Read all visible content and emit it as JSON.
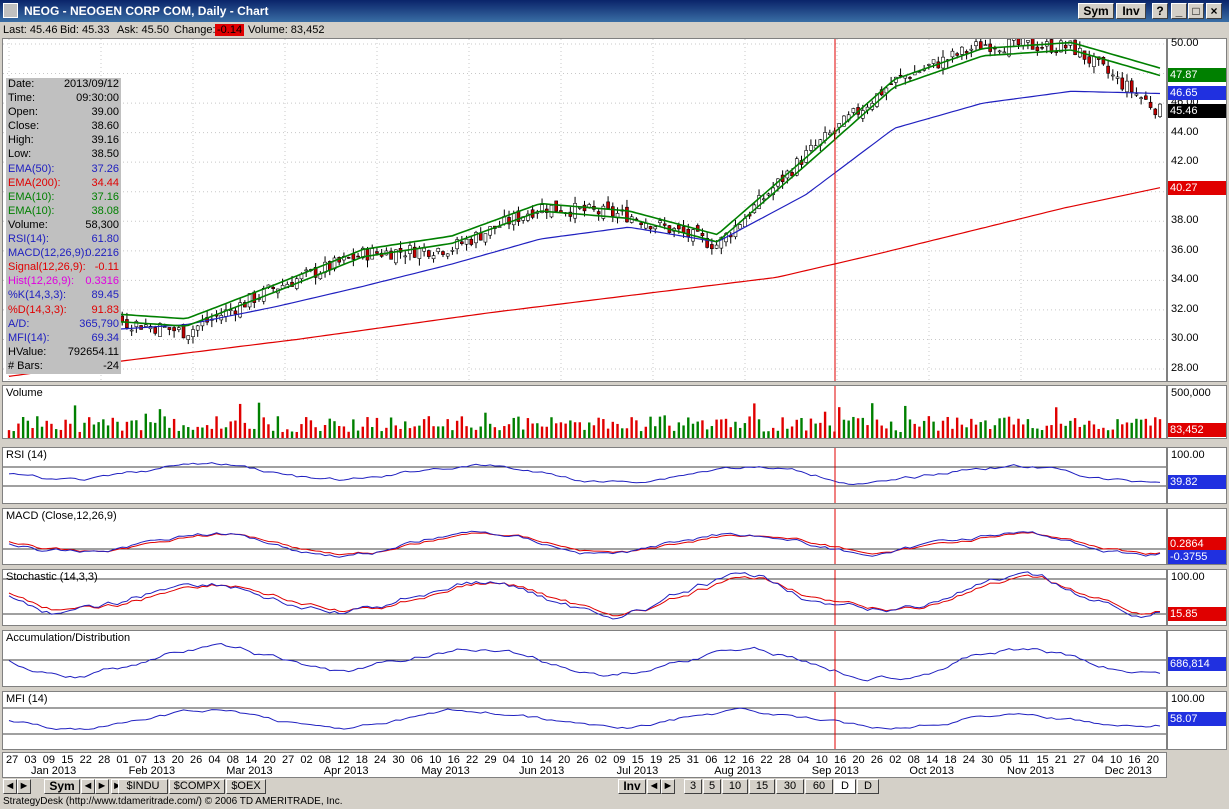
{
  "window": {
    "title": "NEOG - NEOGEN CORP COM, Daily - Chart",
    "sym_btn": "Sym",
    "inv_btn": "Inv"
  },
  "quote": {
    "last": "Last: 45.46",
    "bid": "Bid: 45.33",
    "ask": "Ask: 45.50",
    "change_label": "Change:",
    "change_value": "-0.14",
    "volume": "Volume: 83,452"
  },
  "info": [
    {
      "k": "Date:",
      "v": "2013/09/12",
      "c": "#000"
    },
    {
      "k": "Time:",
      "v": "09:30:00",
      "c": "#000"
    },
    {
      "k": "Open:",
      "v": "39.00",
      "c": "#000"
    },
    {
      "k": "Close:",
      "v": "38.60",
      "c": "#000"
    },
    {
      "k": "High:",
      "v": "39.16",
      "c": "#000"
    },
    {
      "k": "Low:",
      "v": "38.50",
      "c": "#000"
    },
    {
      "k": "EMA(50):",
      "v": "37.26",
      "c": "#2020c0"
    },
    {
      "k": "EMA(200):",
      "v": "34.44",
      "c": "#e00000"
    },
    {
      "k": "EMA(10):",
      "v": "37.16",
      "c": "#008000"
    },
    {
      "k": "EMA(10):",
      "v": "38.08",
      "c": "#008000"
    },
    {
      "k": "Volume:",
      "v": "58,300",
      "c": "#000"
    },
    {
      "k": "RSI(14):",
      "v": "61.80",
      "c": "#2020c0"
    },
    {
      "k": "MACD(12,26,9):",
      "v": "0.2216",
      "c": "#2020c0"
    },
    {
      "k": "Signal(12,26,9):",
      "v": "-0.11",
      "c": "#e00000"
    },
    {
      "k": "Hist(12,26,9):",
      "v": "0.3316",
      "c": "#e000e0"
    },
    {
      "k": "%K(14,3,3):",
      "v": "89.45",
      "c": "#2020c0"
    },
    {
      "k": "%D(14,3,3):",
      "v": "91.83",
      "c": "#e00000"
    },
    {
      "k": "A/D:",
      "v": "365,790",
      "c": "#2020c0"
    },
    {
      "k": "MFI(14):",
      "v": "69.34",
      "c": "#2020c0"
    },
    {
      "k": "HValue:",
      "v": "792654.11",
      "c": "#000"
    },
    {
      "k": "# Bars:",
      "v": "-24",
      "c": "#000"
    }
  ],
  "price_axis": {
    "ticks": [
      "50.00",
      "48.00",
      "46.00",
      "44.00",
      "42.00",
      "40.00",
      "38.00",
      "36.00",
      "34.00",
      "32.00",
      "30.00",
      "28.00"
    ],
    "tags": [
      {
        "v": "47.87",
        "bg": "#008000",
        "fg": "#fff"
      },
      {
        "v": "46.65",
        "bg": "#2030e0",
        "fg": "#fff"
      },
      {
        "v": "45.46",
        "bg": "#000",
        "fg": "#fff"
      },
      {
        "v": "40.27",
        "bg": "#e00000",
        "fg": "#fff"
      }
    ]
  },
  "volume_pane": {
    "title": "Volume",
    "tick": "500,000",
    "tag": "83,452"
  },
  "rsi_pane": {
    "title": "RSI (14)",
    "tick": "100.00",
    "tag": "39.82"
  },
  "macd_pane": {
    "title": "MACD (Close,12,26,9)",
    "tag1": "0.2864",
    "tag2": "-0.3755"
  },
  "stoch_pane": {
    "title": "Stochastic (14,3,3)",
    "tick": "100.00",
    "tag": "15.85"
  },
  "ad_pane": {
    "title": "Accumulation/Distribution",
    "tag": "686,814"
  },
  "mfi_pane": {
    "title": "MFI (14)",
    "tick": "100.00",
    "tag": "58.07"
  },
  "x_axis": {
    "days": [
      "27",
      "03",
      "09",
      "15",
      "22",
      "28",
      "01",
      "07",
      "13",
      "20",
      "26",
      "04",
      "08",
      "14",
      "20",
      "27",
      "02",
      "08",
      "12",
      "18",
      "24",
      "30",
      "06",
      "10",
      "16",
      "22",
      "29",
      "04",
      "10",
      "14",
      "20",
      "26",
      "02",
      "09",
      "15",
      "19",
      "25",
      "31",
      "06",
      "12",
      "16",
      "22",
      "28",
      "04",
      "10",
      "16",
      "20",
      "26",
      "02",
      "08",
      "14",
      "18",
      "24",
      "30",
      "05",
      "11",
      "15",
      "21",
      "27",
      "04",
      "10",
      "16",
      "20"
    ],
    "months": [
      "Jan 2013",
      "Feb 2013",
      "Mar 2013",
      "Apr 2013",
      "May 2013",
      "Jun 2013",
      "Jul 2013",
      "Aug 2013",
      "Sep 2013",
      "Oct 2013",
      "Nov 2013",
      "Dec 2013"
    ]
  },
  "bottom_bar": {
    "sym": "Sym",
    "sym1": "$INDU",
    "sym2": "$COMPX",
    "sym3": "$OEX",
    "inv": "Inv",
    "periods": [
      "3",
      "5",
      "10",
      "15",
      "30",
      "60",
      "D",
      "D"
    ]
  },
  "status": "StrategyDesk (http://www.tdameritrade.com/) © 2006 TD AMERITRADE, Inc.",
  "colors": {
    "ema200": "#e00000",
    "ema50": "#2020c0",
    "ema10": "#008000",
    "up": "#ffffff",
    "down": "#c00000",
    "cursor": "#e00000"
  },
  "chart_data": [
    {
      "type": "candlestick",
      "title": "NEOG - NEOGEN CORP COM, Daily",
      "x_range": [
        "2012-12-27",
        "2013-12-20"
      ],
      "ylim": [
        27,
        51
      ],
      "series": [
        {
          "name": "EMA(200)",
          "x": [
            "Dec 27",
            "Feb 01",
            "Mar 01",
            "Apr 01",
            "May 01",
            "Jun 01",
            "Jul 01",
            "Aug 01",
            "Sep 01",
            "Oct 01",
            "Nov 01",
            "Dec 01",
            "Dec 20"
          ],
          "values": [
            27.5,
            28.4,
            29.2,
            30.0,
            30.9,
            31.8,
            32.6,
            33.4,
            34.2,
            35.7,
            37.3,
            38.9,
            40.27
          ]
        },
        {
          "name": "EMA(50)",
          "x": [
            "Dec 27",
            "Feb 01",
            "Mar 01",
            "Apr 01",
            "May 01",
            "Jun 01",
            "Jul 01",
            "Aug 01",
            "Sep 01",
            "Oct 01",
            "Nov 01",
            "Dec 01",
            "Dec 10",
            "Dec 20"
          ],
          "values": [
            30.0,
            30.6,
            31.0,
            32.2,
            33.6,
            35.1,
            36.8,
            37.6,
            36.6,
            39.8,
            44.3,
            46.0,
            46.8,
            46.65
          ]
        },
        {
          "name": "EMA(10)",
          "x": [
            "Dec 27",
            "Feb 01",
            "Mar 01",
            "Apr 01",
            "May 01",
            "Jun 01",
            "Jul 01",
            "Aug 01",
            "Sep 01",
            "Oct 01",
            "Nov 01",
            "Dec 01",
            "Dec 10",
            "Dec 20"
          ],
          "values": [
            30.4,
            31.3,
            30.9,
            33.2,
            35.6,
            36.5,
            38.7,
            38.2,
            36.6,
            41.8,
            47.1,
            49.2,
            49.6,
            47.87
          ]
        },
        {
          "name": "Close",
          "x": [
            "Dec 27",
            "Feb 01",
            "Mar 01",
            "Apr 01",
            "May 01",
            "Jun 01",
            "Jul 01",
            "Aug 01",
            "Sep 01",
            "Oct 01",
            "Nov 01",
            "Dec 01",
            "Dec 10",
            "Dec 20"
          ],
          "values": [
            30.0,
            31.5,
            30.5,
            33.5,
            35.8,
            36.2,
            39.0,
            38.4,
            36.4,
            42.5,
            47.5,
            50.0,
            49.8,
            45.46
          ]
        }
      ]
    }
  ]
}
